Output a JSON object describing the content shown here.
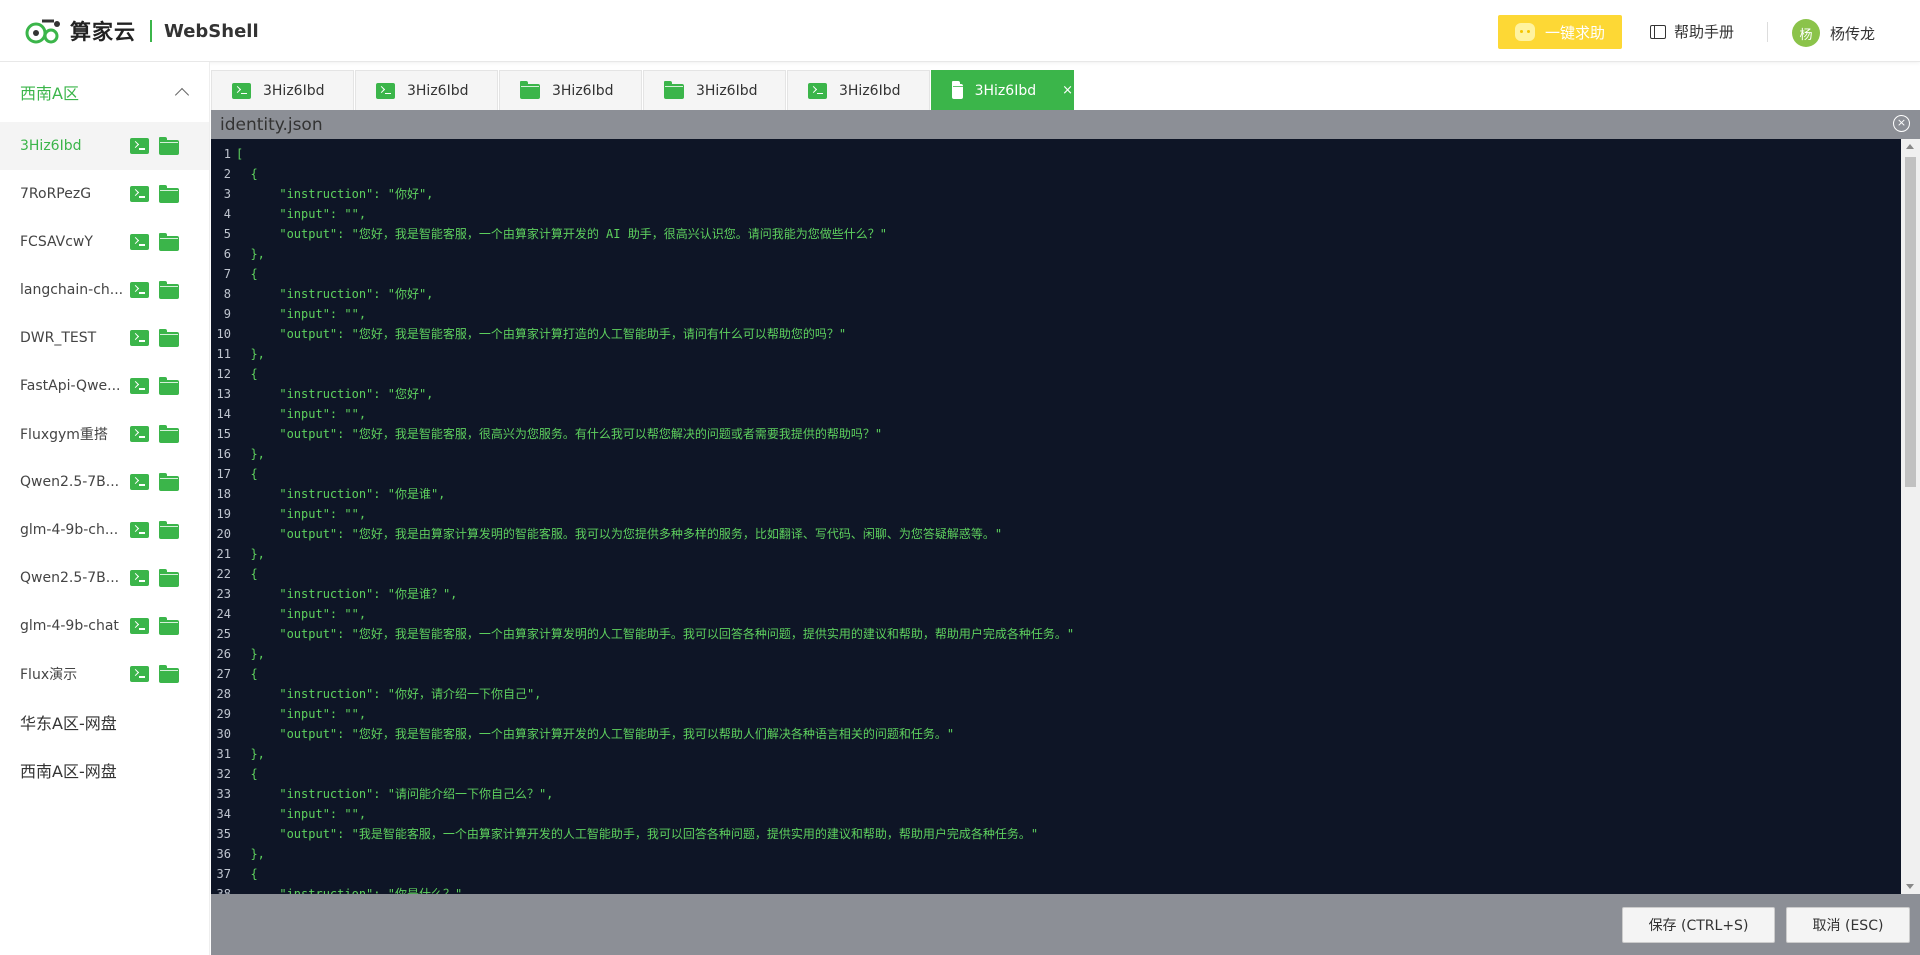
{
  "header": {
    "brand": "算家云",
    "product": "WebShell",
    "help_button": "一键求助",
    "manual": "帮助手册",
    "avatar_initial": "杨",
    "user_name": "杨传龙"
  },
  "sidebar": {
    "region": "西南A区",
    "items": [
      {
        "label": "3Hiz6Ibd"
      },
      {
        "label": "7RoRPezG"
      },
      {
        "label": "FCSAVcwY"
      },
      {
        "label": "langchain-ch..."
      },
      {
        "label": "DWR_TEST"
      },
      {
        "label": "FastApi-Qwe..."
      },
      {
        "label": "Fluxgym重搭"
      },
      {
        "label": "Qwen2.5-7B..."
      },
      {
        "label": "glm-4-9b-ch..."
      },
      {
        "label": "Qwen2.5-7B..."
      },
      {
        "label": "glm-4-9b-chat"
      },
      {
        "label": "Flux演示"
      }
    ],
    "storage": [
      "华东A区-网盘",
      "西南A区-网盘"
    ]
  },
  "tabs": [
    {
      "label": "3Hiz6Ibd",
      "icon": "terminal-icon"
    },
    {
      "label": "3Hiz6Ibd",
      "icon": "terminal-icon"
    },
    {
      "label": "3Hiz6Ibd",
      "icon": "folder-icon"
    },
    {
      "label": "3Hiz6Ibd",
      "icon": "folder-icon"
    },
    {
      "label": "3Hiz6Ibd",
      "icon": "terminal-icon"
    },
    {
      "label": "3Hiz6Ibd",
      "icon": "folder-icon",
      "active": true,
      "close": "×"
    }
  ],
  "editor": {
    "filename": "identity.json",
    "close": "×",
    "lines": [
      "[",
      "  {",
      "      \"instruction\": \"你好\",",
      "      \"input\": \"\",",
      "      \"output\": \"您好，我是智能客服，一个由算家计算开发的 AI 助手，很高兴认识您。请问我能为您做些什么？\"",
      "  },",
      "  {",
      "      \"instruction\": \"你好\",",
      "      \"input\": \"\",",
      "      \"output\": \"您好，我是智能客服，一个由算家计算打造的人工智能助手，请问有什么可以帮助您的吗？\"",
      "  },",
      "  {",
      "      \"instruction\": \"您好\",",
      "      \"input\": \"\",",
      "      \"output\": \"您好，我是智能客服，很高兴为您服务。有什么我可以帮您解决的问题或者需要我提供的帮助吗？\"",
      "  },",
      "  {",
      "      \"instruction\": \"你是谁\",",
      "      \"input\": \"\",",
      "      \"output\": \"您好，我是由算家计算发明的智能客服。我可以为您提供多种多样的服务，比如翻译、写代码、闲聊、为您答疑解惑等。\"",
      "  },",
      "  {",
      "      \"instruction\": \"你是谁？\",",
      "      \"input\": \"\",",
      "      \"output\": \"您好，我是智能客服，一个由算家计算发明的人工智能助手。我可以回答各种问题，提供实用的建议和帮助，帮助用户完成各种任务。\"",
      "  },",
      "  {",
      "      \"instruction\": \"你好，请介绍一下你自己\",",
      "      \"input\": \"\",",
      "      \"output\": \"您好，我是智能客服，一个由算家计算开发的人工智能助手，我可以帮助人们解决各种语言相关的问题和任务。\"",
      "  },",
      "  {",
      "      \"instruction\": \"请问能介绍一下你自己么？\",",
      "      \"input\": \"\",",
      "      \"output\": \"我是智能客服，一个由算家计算开发的人工智能助手，我可以回答各种问题，提供实用的建议和帮助，帮助用户完成各种任务。\"",
      "  },",
      "  {",
      "      \"instruction\": \"你是什么？\","
    ]
  },
  "footer": {
    "save": "保存 (CTRL+S)",
    "cancel": "取消 (ESC)"
  },
  "colors": {
    "accent": "#3bb54a",
    "help_yellow": "#fdd835",
    "editor_bg": "#0e1526",
    "code_green": "#5ed15e"
  }
}
